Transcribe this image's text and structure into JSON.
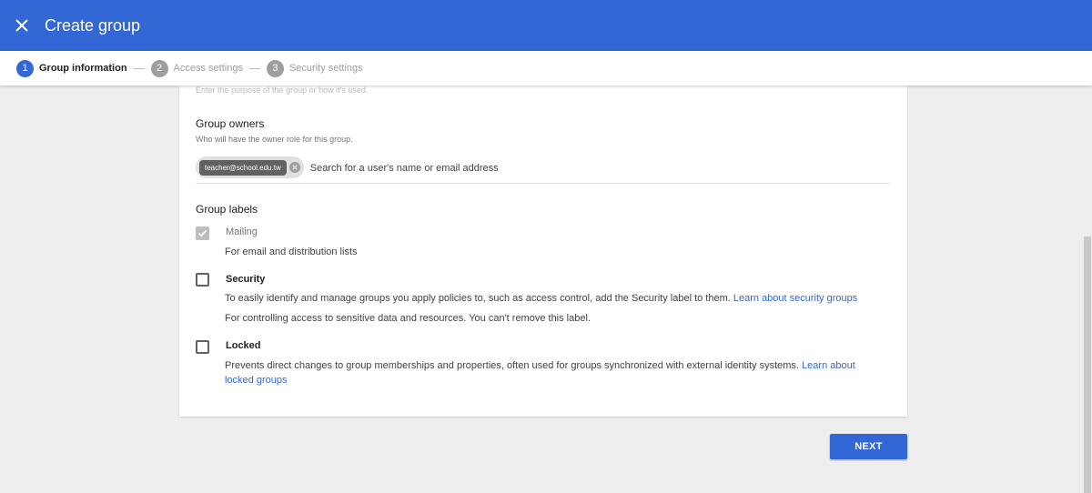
{
  "header": {
    "title": "Create group"
  },
  "stepper": {
    "steps": [
      {
        "number": "1",
        "label": "Group information"
      },
      {
        "number": "2",
        "label": "Access settings"
      },
      {
        "number": "3",
        "label": "Security settings"
      }
    ]
  },
  "description_hint": "Enter the purpose of the group or how it's used.",
  "owners": {
    "title": "Group owners",
    "subtitle": "Who will have the owner role for this group.",
    "chip_email": "teacher@school.edu.tw",
    "search_placeholder": "Search for a user's name or email address"
  },
  "labels": {
    "title": "Group labels",
    "mailing": {
      "title": "Mailing",
      "description": "For email and distribution lists"
    },
    "security": {
      "title": "Security",
      "description": "To easily identify and manage groups you apply policies to, such as access control, add the Security label to them.",
      "link": "Learn about security groups",
      "note": "For controlling access to sensitive data and resources. You can't remove this label."
    },
    "locked": {
      "title": "Locked",
      "description": "Prevents direct changes to group memberships and properties, often used for groups synchronized with external identity systems.",
      "link": "Learn about locked groups"
    }
  },
  "actions": {
    "next": "NEXT"
  }
}
